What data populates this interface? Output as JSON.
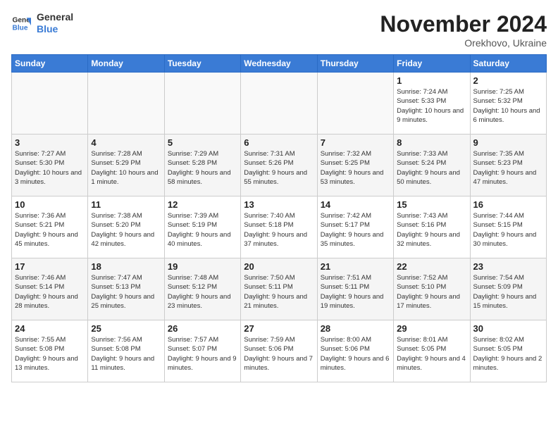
{
  "header": {
    "logo_line1": "General",
    "logo_line2": "Blue",
    "month_title": "November 2024",
    "location": "Orekhovo, Ukraine"
  },
  "days_of_week": [
    "Sunday",
    "Monday",
    "Tuesday",
    "Wednesday",
    "Thursday",
    "Friday",
    "Saturday"
  ],
  "weeks": [
    [
      {
        "day": "",
        "info": ""
      },
      {
        "day": "",
        "info": ""
      },
      {
        "day": "",
        "info": ""
      },
      {
        "day": "",
        "info": ""
      },
      {
        "day": "",
        "info": ""
      },
      {
        "day": "1",
        "info": "Sunrise: 7:24 AM\nSunset: 5:33 PM\nDaylight: 10 hours and 9 minutes."
      },
      {
        "day": "2",
        "info": "Sunrise: 7:25 AM\nSunset: 5:32 PM\nDaylight: 10 hours and 6 minutes."
      }
    ],
    [
      {
        "day": "3",
        "info": "Sunrise: 7:27 AM\nSunset: 5:30 PM\nDaylight: 10 hours and 3 minutes."
      },
      {
        "day": "4",
        "info": "Sunrise: 7:28 AM\nSunset: 5:29 PM\nDaylight: 10 hours and 1 minute."
      },
      {
        "day": "5",
        "info": "Sunrise: 7:29 AM\nSunset: 5:28 PM\nDaylight: 9 hours and 58 minutes."
      },
      {
        "day": "6",
        "info": "Sunrise: 7:31 AM\nSunset: 5:26 PM\nDaylight: 9 hours and 55 minutes."
      },
      {
        "day": "7",
        "info": "Sunrise: 7:32 AM\nSunset: 5:25 PM\nDaylight: 9 hours and 53 minutes."
      },
      {
        "day": "8",
        "info": "Sunrise: 7:33 AM\nSunset: 5:24 PM\nDaylight: 9 hours and 50 minutes."
      },
      {
        "day": "9",
        "info": "Sunrise: 7:35 AM\nSunset: 5:23 PM\nDaylight: 9 hours and 47 minutes."
      }
    ],
    [
      {
        "day": "10",
        "info": "Sunrise: 7:36 AM\nSunset: 5:21 PM\nDaylight: 9 hours and 45 minutes."
      },
      {
        "day": "11",
        "info": "Sunrise: 7:38 AM\nSunset: 5:20 PM\nDaylight: 9 hours and 42 minutes."
      },
      {
        "day": "12",
        "info": "Sunrise: 7:39 AM\nSunset: 5:19 PM\nDaylight: 9 hours and 40 minutes."
      },
      {
        "day": "13",
        "info": "Sunrise: 7:40 AM\nSunset: 5:18 PM\nDaylight: 9 hours and 37 minutes."
      },
      {
        "day": "14",
        "info": "Sunrise: 7:42 AM\nSunset: 5:17 PM\nDaylight: 9 hours and 35 minutes."
      },
      {
        "day": "15",
        "info": "Sunrise: 7:43 AM\nSunset: 5:16 PM\nDaylight: 9 hours and 32 minutes."
      },
      {
        "day": "16",
        "info": "Sunrise: 7:44 AM\nSunset: 5:15 PM\nDaylight: 9 hours and 30 minutes."
      }
    ],
    [
      {
        "day": "17",
        "info": "Sunrise: 7:46 AM\nSunset: 5:14 PM\nDaylight: 9 hours and 28 minutes."
      },
      {
        "day": "18",
        "info": "Sunrise: 7:47 AM\nSunset: 5:13 PM\nDaylight: 9 hours and 25 minutes."
      },
      {
        "day": "19",
        "info": "Sunrise: 7:48 AM\nSunset: 5:12 PM\nDaylight: 9 hours and 23 minutes."
      },
      {
        "day": "20",
        "info": "Sunrise: 7:50 AM\nSunset: 5:11 PM\nDaylight: 9 hours and 21 minutes."
      },
      {
        "day": "21",
        "info": "Sunrise: 7:51 AM\nSunset: 5:11 PM\nDaylight: 9 hours and 19 minutes."
      },
      {
        "day": "22",
        "info": "Sunrise: 7:52 AM\nSunset: 5:10 PM\nDaylight: 9 hours and 17 minutes."
      },
      {
        "day": "23",
        "info": "Sunrise: 7:54 AM\nSunset: 5:09 PM\nDaylight: 9 hours and 15 minutes."
      }
    ],
    [
      {
        "day": "24",
        "info": "Sunrise: 7:55 AM\nSunset: 5:08 PM\nDaylight: 9 hours and 13 minutes."
      },
      {
        "day": "25",
        "info": "Sunrise: 7:56 AM\nSunset: 5:08 PM\nDaylight: 9 hours and 11 minutes."
      },
      {
        "day": "26",
        "info": "Sunrise: 7:57 AM\nSunset: 5:07 PM\nDaylight: 9 hours and 9 minutes."
      },
      {
        "day": "27",
        "info": "Sunrise: 7:59 AM\nSunset: 5:06 PM\nDaylight: 9 hours and 7 minutes."
      },
      {
        "day": "28",
        "info": "Sunrise: 8:00 AM\nSunset: 5:06 PM\nDaylight: 9 hours and 6 minutes."
      },
      {
        "day": "29",
        "info": "Sunrise: 8:01 AM\nSunset: 5:05 PM\nDaylight: 9 hours and 4 minutes."
      },
      {
        "day": "30",
        "info": "Sunrise: 8:02 AM\nSunset: 5:05 PM\nDaylight: 9 hours and 2 minutes."
      }
    ]
  ]
}
